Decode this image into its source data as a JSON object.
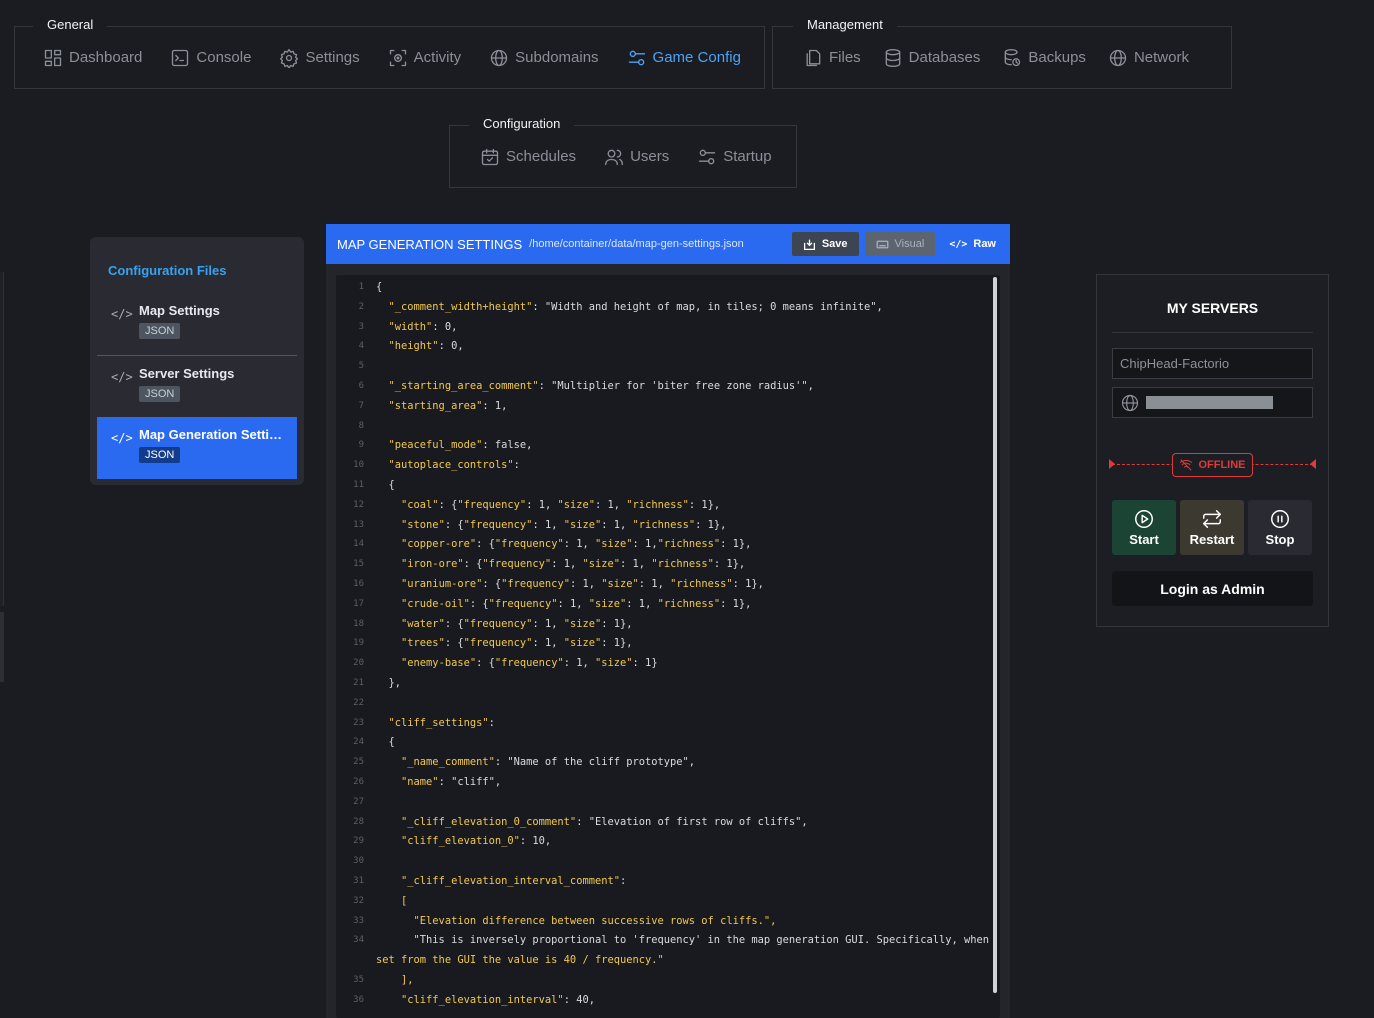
{
  "nav": {
    "general": {
      "legend": "General",
      "items": [
        {
          "label": "Dashboard",
          "icon": "dashboard-icon",
          "active": false
        },
        {
          "label": "Console",
          "icon": "console-icon",
          "active": false
        },
        {
          "label": "Settings",
          "icon": "gear-icon",
          "active": false
        },
        {
          "label": "Activity",
          "icon": "activity-icon",
          "active": false
        },
        {
          "label": "Subdomains",
          "icon": "globe-icon",
          "active": false
        },
        {
          "label": "Game Config",
          "icon": "sliders-icon",
          "active": true
        }
      ]
    },
    "management": {
      "legend": "Management",
      "items": [
        {
          "label": "Files",
          "icon": "files-icon"
        },
        {
          "label": "Databases",
          "icon": "database-icon"
        },
        {
          "label": "Backups",
          "icon": "backup-icon"
        },
        {
          "label": "Network",
          "icon": "globe-icon"
        }
      ]
    },
    "configuration": {
      "legend": "Configuration",
      "items": [
        {
          "label": "Schedules",
          "icon": "calendar-icon"
        },
        {
          "label": "Users",
          "icon": "users-icon"
        },
        {
          "label": "Startup",
          "icon": "sliders-icon"
        }
      ]
    }
  },
  "sidebar": {
    "title": "Configuration Files",
    "items": [
      {
        "name": "Map Settings",
        "badge": "JSON",
        "active": false
      },
      {
        "name": "Server Settings",
        "badge": "JSON",
        "active": false
      },
      {
        "name": "Map Generation Settings",
        "badge": "JSON",
        "active": true
      }
    ]
  },
  "editor": {
    "title": "MAP GENERATION SETTINGS",
    "path": "/home/container/data/map-gen-settings.json",
    "buttons": {
      "save": "Save",
      "visual": "Visual",
      "raw": "Raw"
    },
    "lines": [
      {
        "n": "1",
        "t": "{"
      },
      {
        "n": "2",
        "t": "  \"_comment_width+height\": \"Width and height of map, in tiles; 0 means infinite\","
      },
      {
        "n": "3",
        "t": "  \"width\": 0,"
      },
      {
        "n": "4",
        "t": "  \"height\": 0,"
      },
      {
        "n": "5",
        "t": ""
      },
      {
        "n": "6",
        "t": "  \"_starting_area_comment\": \"Multiplier for 'biter free zone radius'\","
      },
      {
        "n": "7",
        "t": "  \"starting_area\": 1,"
      },
      {
        "n": "8",
        "t": ""
      },
      {
        "n": "9",
        "t": "  \"peaceful_mode\": false,"
      },
      {
        "n": "10",
        "t": "  \"autoplace_controls\":"
      },
      {
        "n": "11",
        "t": "  {"
      },
      {
        "n": "12",
        "t": "    \"coal\": {\"frequency\": 1, \"size\": 1, \"richness\": 1},"
      },
      {
        "n": "13",
        "t": "    \"stone\": {\"frequency\": 1, \"size\": 1, \"richness\": 1},"
      },
      {
        "n": "14",
        "t": "    \"copper-ore\": {\"frequency\": 1, \"size\": 1,\"richness\": 1},"
      },
      {
        "n": "15",
        "t": "    \"iron-ore\": {\"frequency\": 1, \"size\": 1, \"richness\": 1},"
      },
      {
        "n": "16",
        "t": "    \"uranium-ore\": {\"frequency\": 1, \"size\": 1, \"richness\": 1},"
      },
      {
        "n": "17",
        "t": "    \"crude-oil\": {\"frequency\": 1, \"size\": 1, \"richness\": 1},"
      },
      {
        "n": "18",
        "t": "    \"water\": {\"frequency\": 1, \"size\": 1},"
      },
      {
        "n": "19",
        "t": "    \"trees\": {\"frequency\": 1, \"size\": 1},"
      },
      {
        "n": "20",
        "t": "    \"enemy-base\": {\"frequency\": 1, \"size\": 1}"
      },
      {
        "n": "21",
        "t": "  },"
      },
      {
        "n": "22",
        "t": ""
      },
      {
        "n": "23",
        "t": "  \"cliff_settings\":"
      },
      {
        "n": "24",
        "t": "  {"
      },
      {
        "n": "25",
        "t": "    \"_name_comment\": \"Name of the cliff prototype\","
      },
      {
        "n": "26",
        "t": "    \"name\": \"cliff\","
      },
      {
        "n": "27",
        "t": ""
      },
      {
        "n": "28",
        "t": "    \"_cliff_elevation_0_comment\": \"Elevation of first row of cliffs\","
      },
      {
        "n": "29",
        "t": "    \"cliff_elevation_0\": 10,"
      },
      {
        "n": "30",
        "t": ""
      },
      {
        "n": "31",
        "t": "    \"_cliff_elevation_interval_comment\":"
      },
      {
        "n": "32",
        "t": "    ["
      },
      {
        "n": "33",
        "t": "      \"Elevation difference between successive rows of cliffs.\","
      },
      {
        "n": "34",
        "t": "      \"This is inversely proportional to 'frequency' in the map generation GUI. Specifically, when"
      },
      {
        "n": "",
        "t": "set from the GUI the value is 40 / frequency.\""
      },
      {
        "n": "35",
        "t": "    ],"
      },
      {
        "n": "36",
        "t": "    \"cliff_elevation_interval\": 40,"
      }
    ]
  },
  "servers": {
    "title": "MY SERVERS",
    "server_name": "ChipHead-Factorio",
    "status": "OFFLINE",
    "status_color": "#e03a3a",
    "controls": {
      "start": "Start",
      "restart": "Restart",
      "stop": "Stop"
    },
    "admin_button": "Login as Admin"
  },
  "colors": {
    "accent": "#2a6af0",
    "active_nav": "#4aa3f5",
    "json_key": "#f2c94c"
  }
}
